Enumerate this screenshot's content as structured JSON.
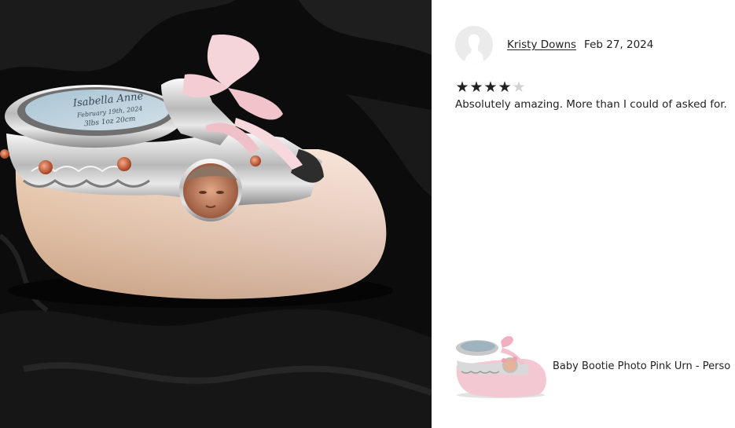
{
  "review": {
    "reviewer_name": "Kristy Downs",
    "date": "Feb 27, 2024",
    "rating": 4,
    "rating_max": 5,
    "stars": [
      "★",
      "★",
      "★",
      "★",
      "★"
    ],
    "text": "Absolutely amazing. More than I could of asked for."
  },
  "photo": {
    "plaque_line_1": "Isabella Anne",
    "plaque_line_2": "February 19th, 2024",
    "plaque_line_3": "3lbs 1oz 20cm"
  },
  "product": {
    "title": "Baby Bootie Photo Pink Urn - Perso"
  },
  "icons": {
    "avatar": "default-user-silhouette-icon",
    "star": "star-icon"
  },
  "colors": {
    "text": "#222222",
    "star_filled": "#222222",
    "star_empty": "#d3d3d3",
    "avatar_bg": "#ebebeb"
  }
}
